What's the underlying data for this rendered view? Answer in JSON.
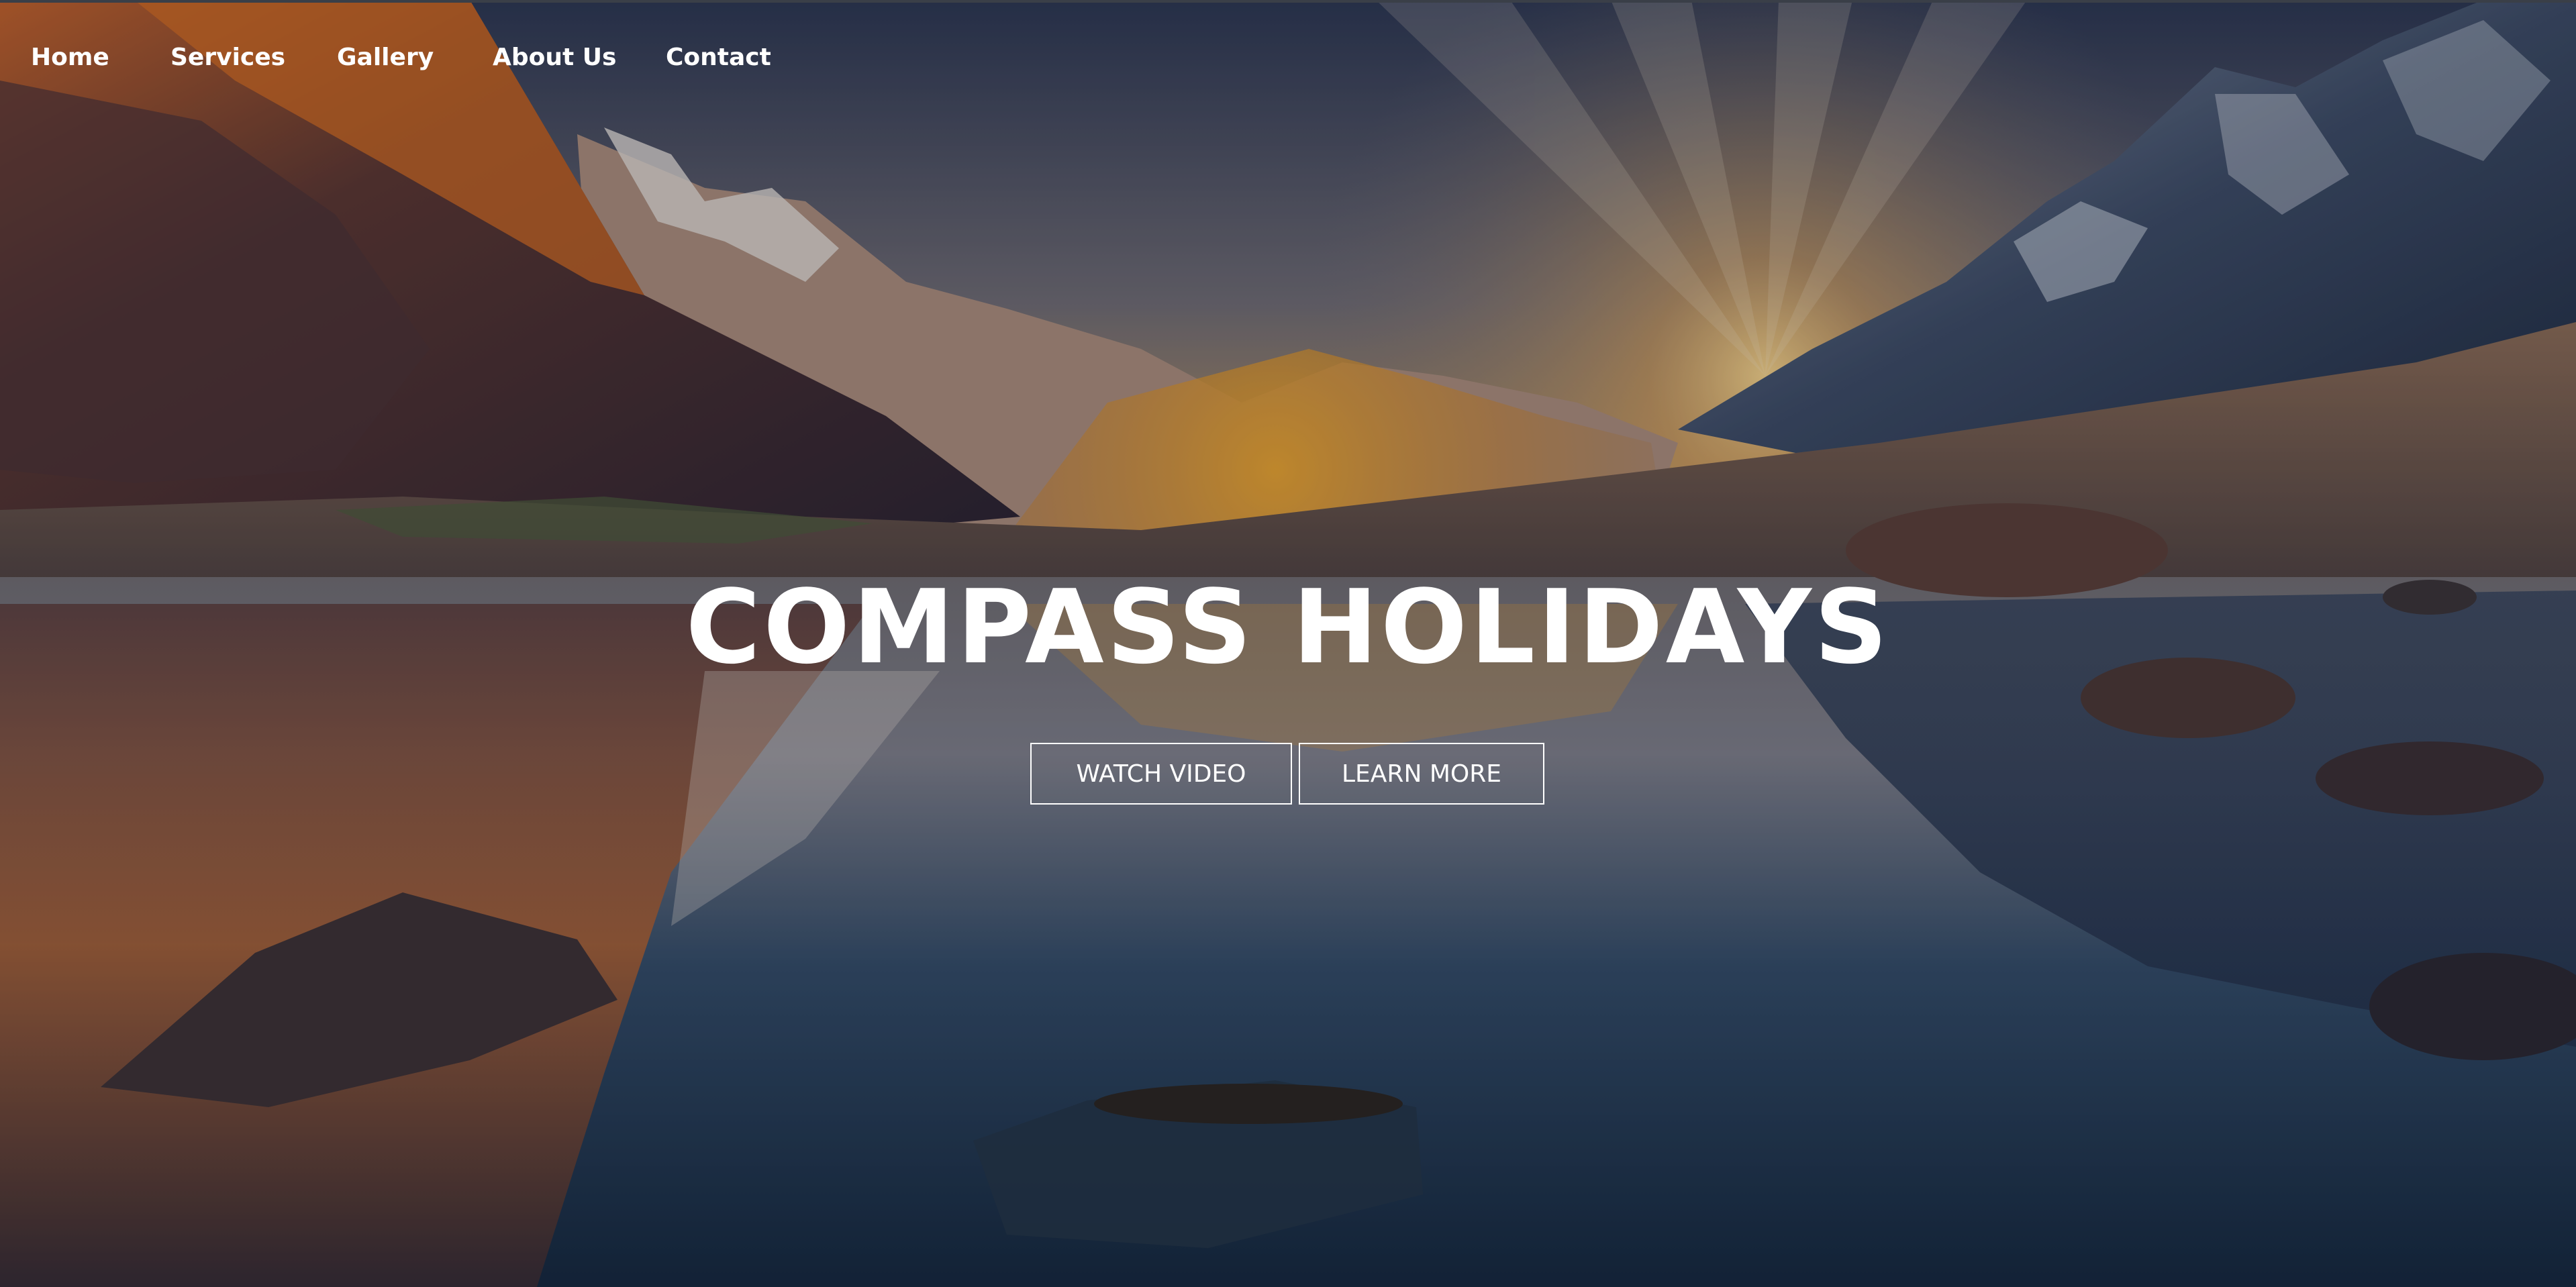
{
  "nav": {
    "items": [
      {
        "label": "Home"
      },
      {
        "label": "Services"
      },
      {
        "label": "Gallery"
      },
      {
        "label": "About Us"
      },
      {
        "label": "Contact"
      }
    ]
  },
  "hero": {
    "title": "COMPASS HOLIDAYS",
    "watch_video_label": "WATCH VIDEO",
    "learn_more_label": "LEARN MORE"
  },
  "colors": {
    "text": "#ffffff",
    "sky_top": "#2a3550",
    "sunset_glow": "#e0a030",
    "water_dark": "#1a2c44",
    "cliff_orange": "#c8662a"
  }
}
